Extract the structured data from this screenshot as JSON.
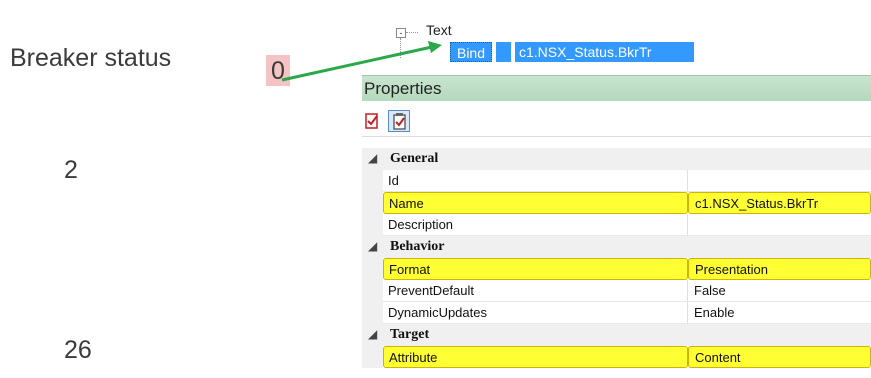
{
  "annotations": {
    "breaker_label": "Breaker status",
    "zero_value": "0",
    "value_two": "2",
    "value_twenty_six": "26"
  },
  "tree": {
    "expander": "-",
    "node_label": "Text",
    "bind_label": "Bind",
    "binding_path": "c1.NSX_Status.BkrTr"
  },
  "properties": {
    "title": "Properties",
    "toolbar": [
      "categorized-icon",
      "alphabetical-icon"
    ],
    "categories": [
      {
        "label": "General",
        "rows": [
          {
            "name": "Id",
            "value": "",
            "highlight": false
          },
          {
            "name": "Name",
            "value": "c1.NSX_Status.BkrTr",
            "highlight": true
          },
          {
            "name": "Description",
            "value": "",
            "highlight": false
          }
        ]
      },
      {
        "label": "Behavior",
        "rows": [
          {
            "name": "Format",
            "value": "Presentation",
            "highlight": true
          },
          {
            "name": "PreventDefault",
            "value": "False",
            "highlight": false
          },
          {
            "name": "DynamicUpdates",
            "value": "Enable",
            "highlight": false
          }
        ]
      },
      {
        "label": "Target",
        "rows": [
          {
            "name": "Attribute",
            "value": "Content",
            "highlight": true
          }
        ]
      }
    ]
  },
  "colors": {
    "selection": "#3399ff",
    "highlight": "#ffff33",
    "arrow": "#2aa84a",
    "zero_bg": "#f4c3c3",
    "header_bg": "#c9e4cf"
  }
}
